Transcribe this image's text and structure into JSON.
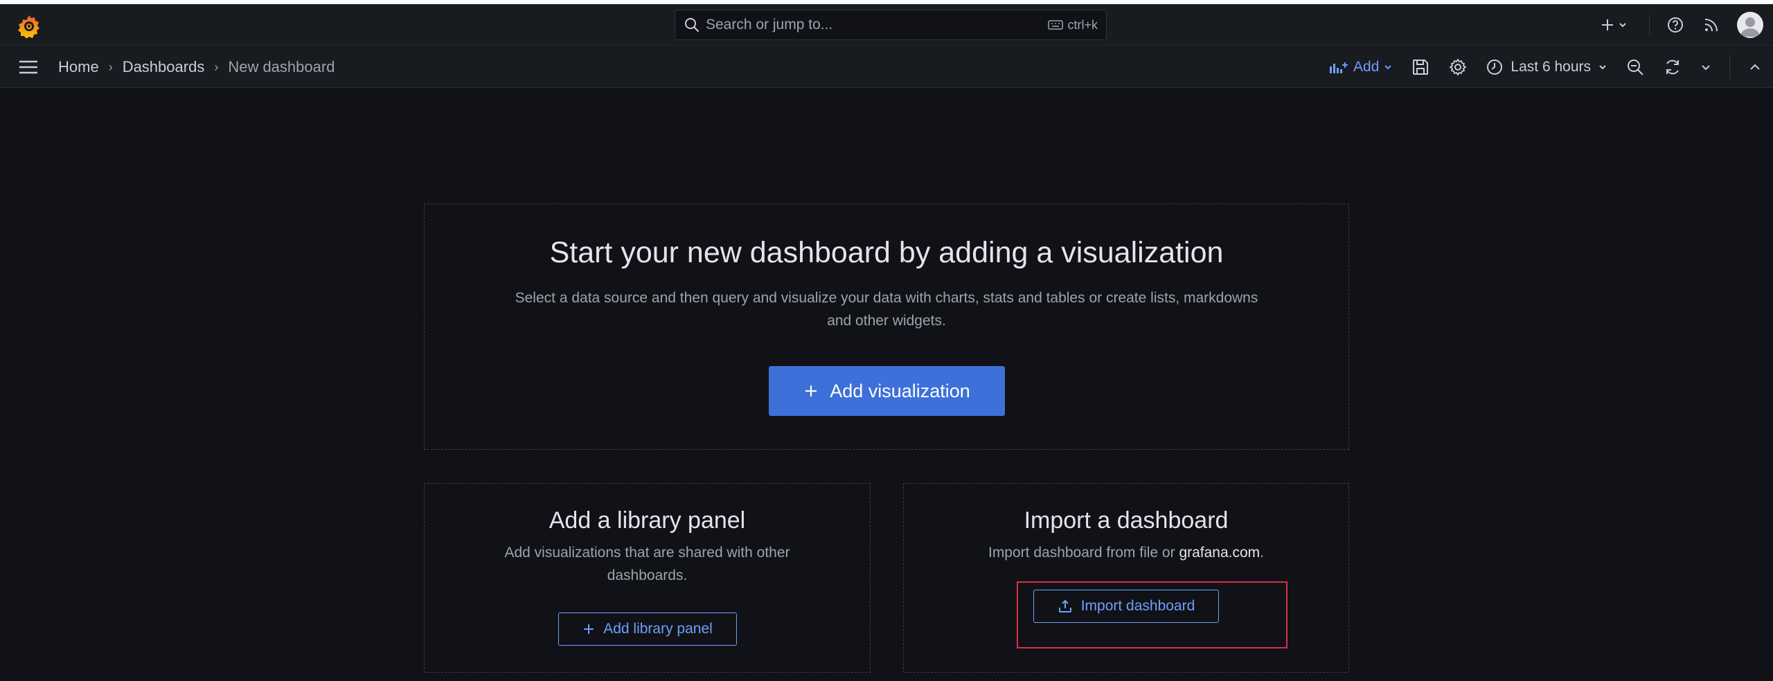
{
  "topbar": {
    "search_placeholder": "Search or jump to...",
    "search_shortcut": "ctrl+k"
  },
  "breadcrumb": {
    "items": [
      "Home",
      "Dashboards",
      "New dashboard"
    ]
  },
  "toolbar": {
    "add_label": "Add",
    "time_range": "Last 6 hours"
  },
  "hero": {
    "title": "Start your new dashboard by adding a visualization",
    "description": "Select a data source and then query and visualize your data with charts, stats and tables or create lists, markdowns and other widgets.",
    "button_label": "Add visualization"
  },
  "library_card": {
    "title": "Add a library panel",
    "description": "Add visualizations that are shared with other dashboards.",
    "button_label": "Add library panel"
  },
  "import_card": {
    "title": "Import a dashboard",
    "description_prefix": "Import dashboard from file or ",
    "description_link": "grafana.com",
    "description_suffix": ".",
    "button_label": "Import dashboard"
  },
  "colors": {
    "background": "#111217",
    "accent": "#3d71d9",
    "link": "#6e9fff",
    "highlight": "#e02f44"
  }
}
